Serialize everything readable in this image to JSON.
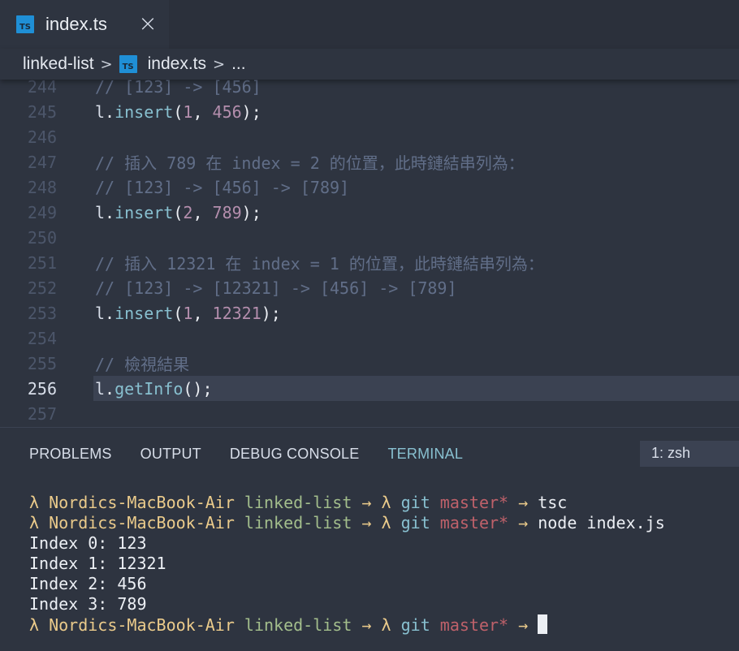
{
  "tab": {
    "icon": "typescript-file-icon",
    "icon_text": "TS",
    "label": "index.ts",
    "close_glyph": "×"
  },
  "breadcrumb": {
    "folder": "linked-list",
    "separator": ">",
    "file_icon_text": "TS",
    "file": "index.ts",
    "more": "..."
  },
  "editor": {
    "current_line": "256",
    "lines": [
      {
        "n": "244",
        "tokens": [
          [
            "comment",
            "// [123] -> [456]"
          ]
        ]
      },
      {
        "n": "245",
        "tokens": [
          [
            "var",
            "l"
          ],
          [
            "punc",
            "."
          ],
          [
            "fn",
            "insert"
          ],
          [
            "punc",
            "("
          ],
          [
            "num",
            "1"
          ],
          [
            "punc",
            ", "
          ],
          [
            "num",
            "456"
          ],
          [
            "punc",
            ");"
          ]
        ]
      },
      {
        "n": "246",
        "tokens": []
      },
      {
        "n": "247",
        "tokens": [
          [
            "comment",
            "// 插入 789 在 index = 2 的位置，此時鏈結串列為："
          ]
        ]
      },
      {
        "n": "248",
        "tokens": [
          [
            "comment",
            "// [123] -> [456] -> [789]"
          ]
        ]
      },
      {
        "n": "249",
        "tokens": [
          [
            "var",
            "l"
          ],
          [
            "punc",
            "."
          ],
          [
            "fn",
            "insert"
          ],
          [
            "punc",
            "("
          ],
          [
            "num",
            "2"
          ],
          [
            "punc",
            ", "
          ],
          [
            "num",
            "789"
          ],
          [
            "punc",
            ");"
          ]
        ]
      },
      {
        "n": "250",
        "tokens": []
      },
      {
        "n": "251",
        "tokens": [
          [
            "comment",
            "// 插入 12321 在 index = 1 的位置，此時鏈結串列為："
          ]
        ]
      },
      {
        "n": "252",
        "tokens": [
          [
            "comment",
            "// [123] -> [12321] -> [456] -> [789]"
          ]
        ]
      },
      {
        "n": "253",
        "tokens": [
          [
            "var",
            "l"
          ],
          [
            "punc",
            "."
          ],
          [
            "fn",
            "insert"
          ],
          [
            "punc",
            "("
          ],
          [
            "num",
            "1"
          ],
          [
            "punc",
            ", "
          ],
          [
            "num",
            "12321"
          ],
          [
            "punc",
            ");"
          ]
        ]
      },
      {
        "n": "254",
        "tokens": []
      },
      {
        "n": "255",
        "tokens": [
          [
            "comment",
            "// 檢視結果"
          ]
        ]
      },
      {
        "n": "256",
        "tokens": [
          [
            "var",
            "l"
          ],
          [
            "punc",
            "."
          ],
          [
            "fn",
            "getInfo"
          ],
          [
            "punc",
            "();"
          ]
        ]
      },
      {
        "n": "257",
        "tokens": []
      }
    ]
  },
  "panel": {
    "tabs": [
      {
        "label": "PROBLEMS",
        "active": false
      },
      {
        "label": "OUTPUT",
        "active": false
      },
      {
        "label": "DEBUG CONSOLE",
        "active": false
      },
      {
        "label": "TERMINAL",
        "active": true
      }
    ],
    "terminal_select": "1: zsh"
  },
  "terminal": {
    "prompt": {
      "lambda": "λ",
      "host": "Nordics-MacBook-Air",
      "dir": "linked-list",
      "arrow": "→",
      "git": "git",
      "branch": "master*"
    },
    "lines": [
      {
        "type": "prompt",
        "cmd": "tsc"
      },
      {
        "type": "prompt",
        "cmd": "node index.js"
      },
      {
        "type": "output",
        "text": "Index 0: 123"
      },
      {
        "type": "output",
        "text": "Index 1: 12321"
      },
      {
        "type": "output",
        "text": "Index 2: 456"
      },
      {
        "type": "output",
        "text": "Index 3: 789"
      },
      {
        "type": "prompt",
        "cmd": "",
        "cursor": true
      }
    ]
  },
  "colors": {
    "background": "#2e3440",
    "comment": "#616e88",
    "function": "#88c0d0",
    "number": "#b48ead",
    "host": "#ebcb8b",
    "dir": "#a3be8c",
    "branch": "#bf616a",
    "ts_icon": "#1f8fd6"
  }
}
